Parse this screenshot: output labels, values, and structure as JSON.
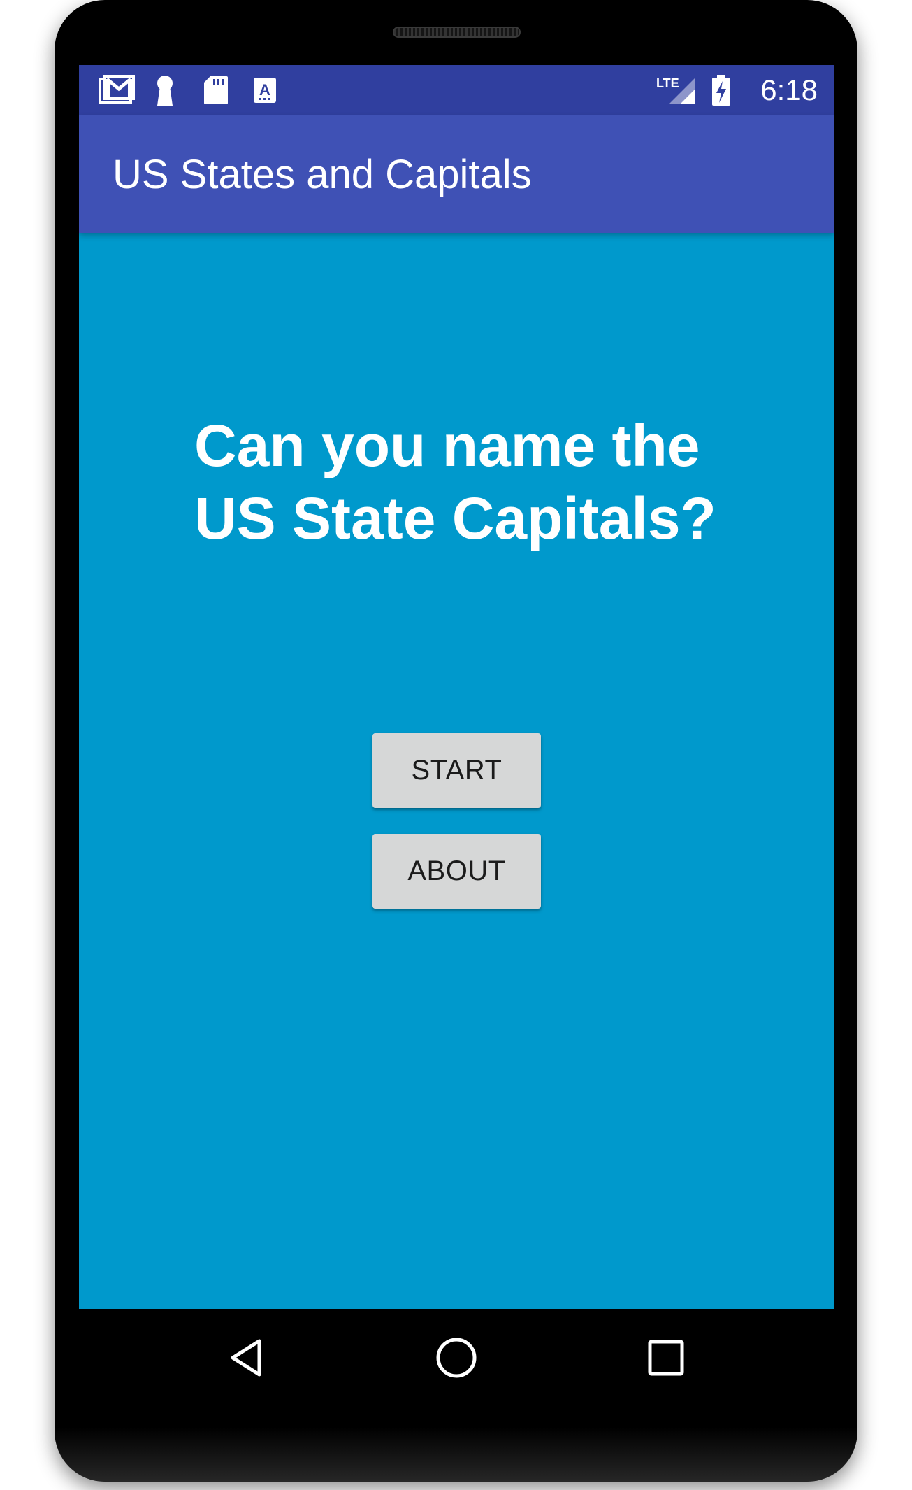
{
  "status_bar": {
    "time": "6:18",
    "icons": [
      "gmail-icon",
      "keyhole-icon",
      "sd-card-icon",
      "keyboard-a-icon",
      "lte-signal-icon",
      "battery-charging-icon"
    ],
    "network_label": "LTE"
  },
  "app_bar": {
    "title": "US States and Capitals"
  },
  "main": {
    "headline_line1": "Can you name the",
    "headline_line2": "US State Capitals?",
    "start_label": "START",
    "about_label": "ABOUT"
  },
  "nav_bar": {
    "icons": [
      "back-icon",
      "home-icon",
      "recents-icon"
    ]
  },
  "colors": {
    "status_bar": "#303f9f",
    "app_bar": "#3f51b5",
    "background": "#0099cc",
    "button": "#d6d7d7"
  }
}
